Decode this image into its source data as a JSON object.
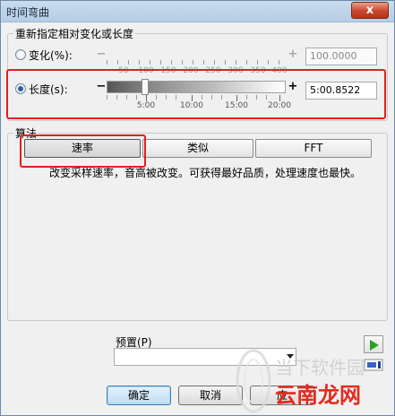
{
  "window": {
    "title": "时间弯曲",
    "close_symbol": "x"
  },
  "retarget_group": {
    "legend": "重新指定相对变化或长度",
    "change": {
      "label": "变化(%):",
      "selected": false,
      "value": "100.0000",
      "minus": "−",
      "plus": "+",
      "tick_labels": [
        "50",
        "100",
        "150",
        "200",
        "250",
        "300",
        "350",
        "400"
      ]
    },
    "length": {
      "label": "长度(s):",
      "selected": true,
      "value": "5:00.8522",
      "minus": "−",
      "plus": "+",
      "tick_labels": [
        "5:00",
        "10:00",
        "15:00",
        "20:00"
      ]
    }
  },
  "algorithm_group": {
    "legend": "算法",
    "buttons": [
      {
        "label": "速率",
        "active": true
      },
      {
        "label": "类似",
        "active": false
      },
      {
        "label": "FFT",
        "active": false
      }
    ],
    "description": "改变采样速率，音高被改变。可获得最好品质，处理速度也最快。"
  },
  "preset": {
    "label": "预置(P)",
    "value": ""
  },
  "footer": {
    "ok": "确定",
    "cancel": "取消",
    "apply": "应"
  },
  "watermark": {
    "line1": "当下软件园",
    "line2": "云南龙网"
  },
  "colors": {
    "highlight_red": "#e02020",
    "play_green": "#2aa02a",
    "watermark_red": "#e32b1e"
  }
}
